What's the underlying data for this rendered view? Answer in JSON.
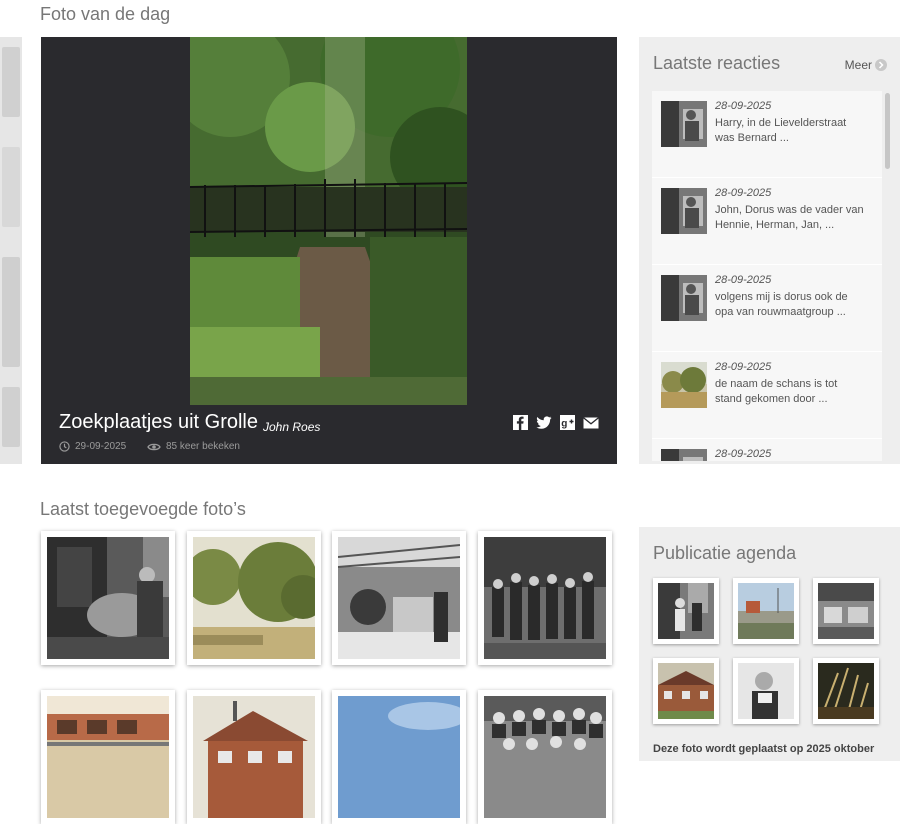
{
  "foto_van_de_dag": {
    "section_title": "Foto van de dag",
    "title": "Zoekplaatjes uit Grolle",
    "author": "John Roes",
    "date": "29-09-2025",
    "views": "85 keer bekeken"
  },
  "laatste_reacties": {
    "title": "Laatste reacties",
    "more_label": "Meer",
    "items": [
      {
        "date": "28-09-2025",
        "text": "Harry, in de Lievelderstraat was Bernard ..."
      },
      {
        "date": "28-09-2025",
        "text": "John, Dorus was de vader van Hennie, Herman, Jan, ..."
      },
      {
        "date": "28-09-2025",
        "text": "volgens mij is dorus ook de opa van rouwmaatgroup ..."
      },
      {
        "date": "28-09-2025",
        "text": "de naam de schans is tot stand gekomen door ..."
      },
      {
        "date": "28-09-2025",
        "text": ""
      }
    ]
  },
  "laatst_toegevoegd": {
    "title": "Laatst toegevoegde foto’s"
  },
  "publicatie_agenda": {
    "title": "Publicatie agenda",
    "note": "Deze foto wordt geplaatst op 2025 oktober"
  },
  "colors": {
    "dark_panel": "#2a2a2e",
    "sidebar_bg": "#eeeeee",
    "text_muted": "#777777"
  }
}
